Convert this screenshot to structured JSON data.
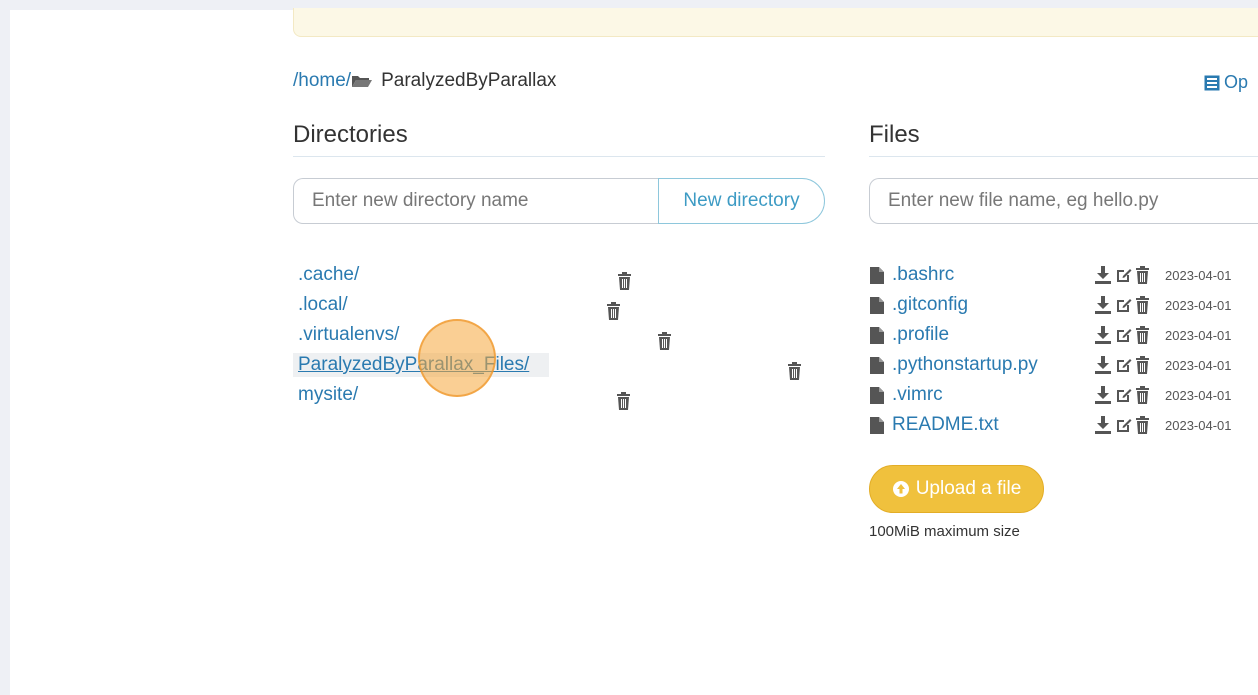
{
  "breadcrumb": {
    "home_link": "/home/",
    "current": "ParalyzedByParallax",
    "open_link": "Op"
  },
  "directories": {
    "title": "Directories",
    "input_placeholder": "Enter new directory name",
    "button_label": "New directory",
    "items": [
      {
        "label": ".cache/"
      },
      {
        "label": ".local/"
      },
      {
        "label": ".virtualenvs/"
      },
      {
        "label": "ParalyzedByParallax_Files/"
      },
      {
        "label": "mysite/"
      }
    ]
  },
  "files": {
    "title": "Files",
    "input_placeholder": "Enter new file name, eg hello.py",
    "items": [
      {
        "label": ".bashrc",
        "date": "2023-04-01"
      },
      {
        "label": ".gitconfig",
        "date": "2023-04-01"
      },
      {
        "label": ".profile",
        "date": "2023-04-01"
      },
      {
        "label": ".pythonstartup.py",
        "date": "2023-04-01"
      },
      {
        "label": ".vimrc",
        "date": "2023-04-01"
      },
      {
        "label": "README.txt",
        "date": "2023-04-01"
      }
    ],
    "upload_label": "Upload a file",
    "upload_note": "100MiB maximum size"
  },
  "colors": {
    "link": "#2a7ab0",
    "upload_button": "#f0c13d",
    "banner": "#fcf8e6",
    "click_marker": "#f5a83c"
  }
}
